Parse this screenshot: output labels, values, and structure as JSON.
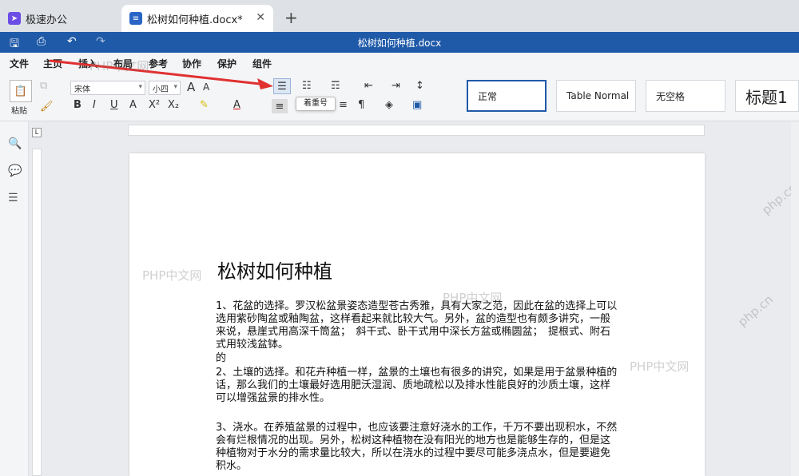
{
  "tabs": [
    {
      "label": "极速办公",
      "active": false
    },
    {
      "label": "松树如何种植.docx*",
      "active": true
    }
  ],
  "window_title": "松树如何种植.docx",
  "menu_items": [
    "文件",
    "主页",
    "插入",
    "布局",
    "参考",
    "协作",
    "保护",
    "组件"
  ],
  "active_menu": "主页",
  "ribbon": {
    "paste_label": "粘贴",
    "font_name": "宋体",
    "font_size": "小四",
    "tooltip": "着重号",
    "styles": [
      "正常",
      "Table Normal",
      "无空格",
      "标题1"
    ]
  },
  "document": {
    "title": "松树如何种植",
    "paragraphs": [
      "1、花盆的选择。罗汉松盆景姿态造型苍古秀雅，具有大家之范，因此在盆的选择上可以选用紫砂陶盆或釉陶盆，这样看起来就比较大气。另外，盆的造型也有颇多讲究，一般来说，悬崖式用高深千筒盆；　斜干式、卧干式用中深长方盆或椭圆盆；　提根式、附石式用较浅盆钵。",
      "的",
      "2、土壤的选择。和花卉种植一样，盆景的土壤也有很多的讲究，如果是用于盆景种植的话，那么我们的土壤最好选用肥沃湿润、质地疏松以及排水性能良好的沙质土壤，这样可以增强盆景的排水性。",
      "3、浇水。在养殖盆景的过程中，也应该要注意好浇水的工作，千万不要出现积水，不然会有烂根情况的出现。另外，松树这种植物在没有阳光的地方也是能够生存的，但是这种植物对于水分的需求量比较大，所以在浇水的过程中要尽可能多浇点水，但是要避免积水。"
    ]
  },
  "watermarks": [
    "PHP中文网",
    "PHP中文网",
    "PHP中文网",
    "PHP中文网",
    "php.cn",
    "php.cn"
  ],
  "colors": {
    "titlebar": "#1f5aa8",
    "accent": "#1f5aa8",
    "arrow": "#e03030"
  }
}
